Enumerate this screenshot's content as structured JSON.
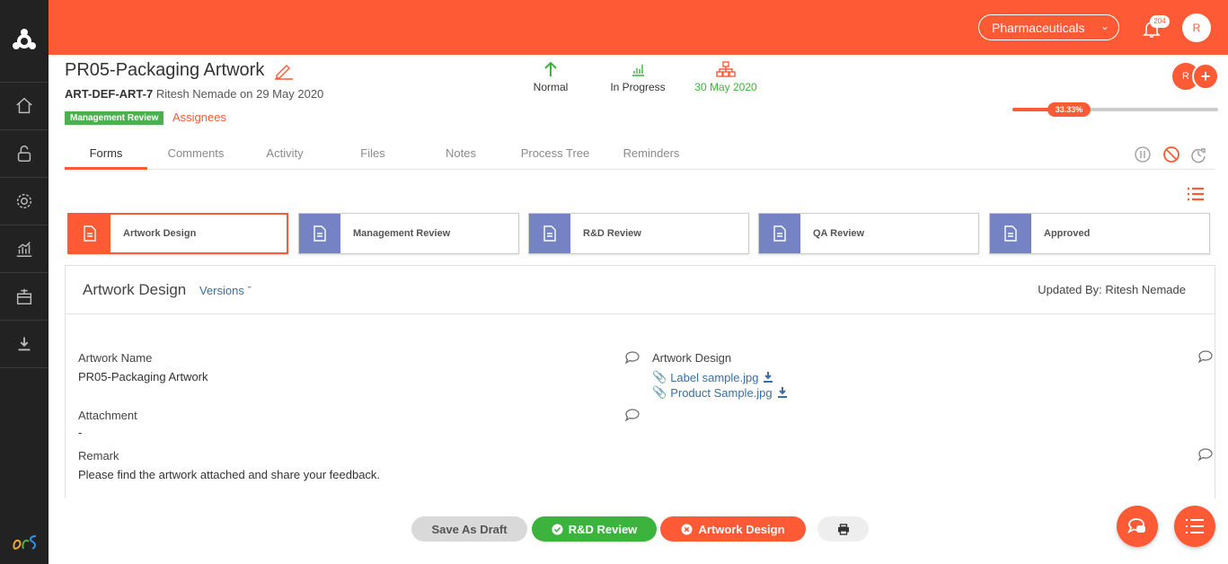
{
  "colors": {
    "accent": "#ff5a36",
    "sidebar": "#222222",
    "stage_pending": "#7583c4",
    "success": "#3cb33c",
    "link": "#3a6ea5"
  },
  "topbar": {
    "organization": "Pharmaceuticals",
    "notification_count": "204",
    "user_initial": "R"
  },
  "header": {
    "title": "PR05-Packaging Artwork",
    "item_id": "ART-DEF-ART-7",
    "created_info": " Ritesh Nemade on 29 May 2020",
    "stage_badge": "Management Review",
    "assignees_label": "Assignees"
  },
  "status": {
    "priority": "Normal",
    "progress_state": "In Progress",
    "due_date": "30 May 2020"
  },
  "assignees": {
    "avatar_initial": "R",
    "add_symbol": "+"
  },
  "progress": {
    "percent": 33.33,
    "label": "33.33%"
  },
  "tabs": [
    {
      "label": "Forms",
      "active": true
    },
    {
      "label": "Comments"
    },
    {
      "label": "Activity"
    },
    {
      "label": "Files"
    },
    {
      "label": "Notes"
    },
    {
      "label": "Process Tree"
    },
    {
      "label": "Reminders"
    }
  ],
  "stages": [
    {
      "label": "Artwork Design",
      "active": true
    },
    {
      "label": "Management Review"
    },
    {
      "label": "R&D Review"
    },
    {
      "label": "QA Review"
    },
    {
      "label": "Approved"
    }
  ],
  "form": {
    "title": "Artwork Design",
    "versions_label": "Versions",
    "updated_by": "Updated By: Ritesh Nemade",
    "fields": {
      "artwork_name_label": "Artwork Name",
      "artwork_name_value": "PR05-Packaging Artwork",
      "attachment_label": "Attachment",
      "attachment_value": "-",
      "remark_label": "Remark",
      "remark_value": "Please find the artwork attached and share your feedback.",
      "artwork_design_label": "Artwork Design",
      "files": [
        "Label sample.jpg",
        "Product Sample.jpg"
      ]
    }
  },
  "actions": {
    "save_draft": "Save As Draft",
    "rd_review": "R&D Review",
    "artwork_design": "Artwork Design"
  }
}
